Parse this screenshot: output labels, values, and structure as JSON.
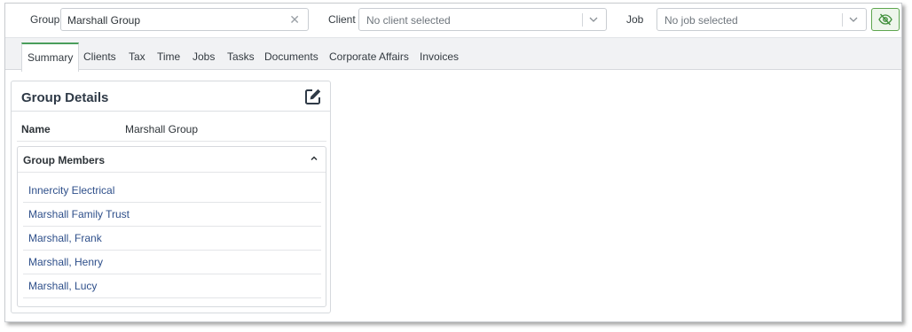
{
  "filters": {
    "group": {
      "label": "Group",
      "value": "Marshall Group"
    },
    "client": {
      "label": "Client",
      "placeholder": "No client selected"
    },
    "job": {
      "label": "Job",
      "placeholder": "No job selected"
    }
  },
  "tabs": [
    {
      "label": "Summary",
      "active": true
    },
    {
      "label": "Clients"
    },
    {
      "label": "Tax"
    },
    {
      "label": "Time"
    },
    {
      "label": "Jobs"
    },
    {
      "label": "Tasks"
    },
    {
      "label": "Documents"
    },
    {
      "label": "Corporate Affairs"
    },
    {
      "label": "Invoices"
    }
  ],
  "group_details": {
    "title": "Group Details",
    "name_label": "Name",
    "name_value": "Marshall Group",
    "members_title": "Group Members",
    "members": [
      "Innercity Electrical",
      "Marshall Family Trust",
      "Marshall, Frank",
      "Marshall, Henry",
      "Marshall, Lucy"
    ]
  },
  "colors": {
    "accent_green": "#4a9e5c",
    "link_blue": "#2e4f8a",
    "tab_bar_bg": "#f1f2f4"
  },
  "icons": {
    "clear": "close-icon",
    "dropdown": "chevron-down-icon",
    "visibility": "eye-off-icon",
    "edit": "edit-icon",
    "collapse": "chevron-up-icon"
  }
}
